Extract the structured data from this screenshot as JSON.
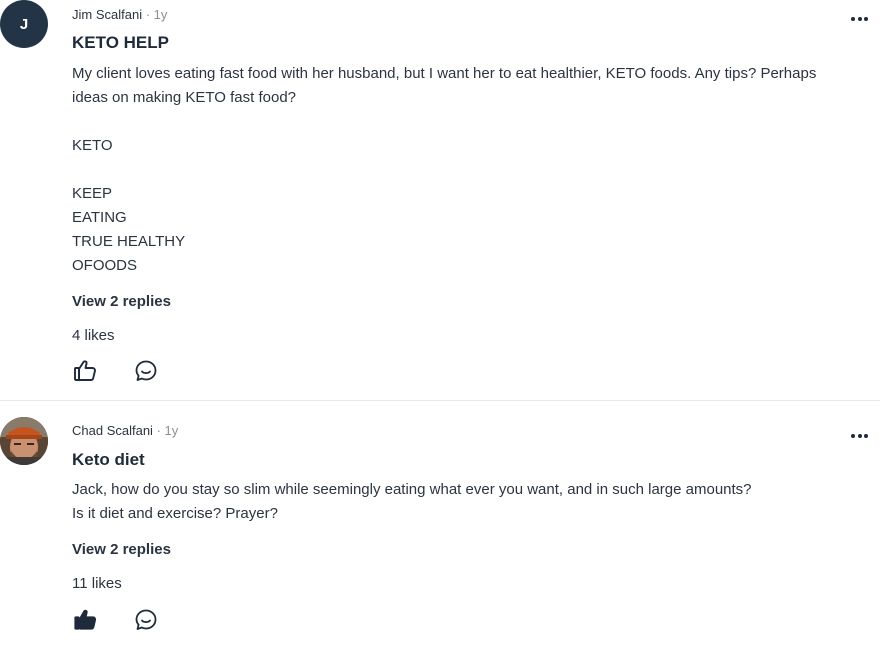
{
  "posts": [
    {
      "avatar_letter": "J",
      "author": "Jim Scalfani",
      "separator": "·",
      "time": "1y",
      "title": "KETO HELP",
      "body": [
        "My client loves eating fast food with her husband, but I want her to eat healthier, KETO foods. Any tips? Perhaps ideas on making KETO fast food?",
        "",
        "KETO",
        "",
        "KEEP",
        "EATING",
        "TRUE HEALTHY",
        "OFOODS"
      ],
      "view_replies": "View 2 replies",
      "likes": "4 likes",
      "liked": false,
      "like_icon": "thumbs-up-outline-icon",
      "reply_icon": "comment-bubble-icon",
      "more_icon": "more-horizontal-icon"
    },
    {
      "avatar_image": "profile-photo",
      "author": "Chad Scalfani",
      "separator": "·",
      "time": "1y",
      "title": "Keto diet",
      "body": [
        "Jack, how do you stay so slim while seemingly eating what ever you want, and in such large amounts?",
        "Is it diet and exercise? Prayer?"
      ],
      "view_replies": "View 2 replies",
      "likes": "11 likes",
      "liked": true,
      "like_icon": "thumbs-up-filled-icon",
      "reply_icon": "comment-bubble-icon",
      "more_icon": "more-horizontal-icon"
    }
  ],
  "colors": {
    "text": "#1f2b3a",
    "muted": "#8a8f98",
    "avatar_bg": "#233447",
    "divider": "#e8e8e8"
  }
}
